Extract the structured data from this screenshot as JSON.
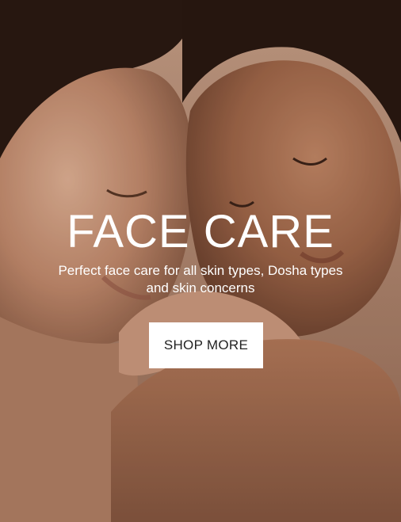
{
  "hero": {
    "title": "FACE CARE",
    "subtitle": "Perfect face care for all skin types, Dosha types and skin concerns",
    "button_label": "SHOP MORE",
    "image_description_icon": "photo-two-women-faces"
  },
  "colors": {
    "text": "#ffffff",
    "button_bg": "#ffffff",
    "button_text": "#222222"
  }
}
